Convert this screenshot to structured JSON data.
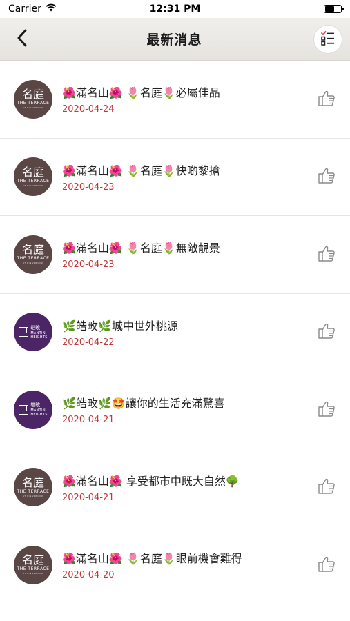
{
  "status_bar": {
    "carrier": "Carrier",
    "time": "12:31 PM",
    "battery_level": 0.6
  },
  "nav": {
    "title": "最新消息",
    "back_icon": "chevron-left-icon",
    "menu_icon": "checklist-icon"
  },
  "items": [
    {
      "logo_type": "terrace",
      "logo_main": "名庭",
      "logo_sub": "THE TERRACE",
      "logo_sub2": "AT KINGSWOOD",
      "title": "🌺滿名山🌺 🌷名庭🌷必屬佳品",
      "date": "2020-04-24"
    },
    {
      "logo_type": "terrace",
      "logo_main": "名庭",
      "logo_sub": "THE TERRACE",
      "logo_sub2": "AT KINGSWOOD",
      "title": "🌺滿名山🌺 🌷名庭🌷快啲黎搶",
      "date": "2020-04-23"
    },
    {
      "logo_type": "terrace",
      "logo_main": "名庭",
      "logo_sub": "THE TERRACE",
      "logo_sub2": "AT KINGSWOOD",
      "title": "🌺滿名山🌺 🌷名庭🌷無敵靚景",
      "date": "2020-04-23"
    },
    {
      "logo_type": "mantin",
      "logo_main": "皓畋",
      "logo_sub": "MANTIN",
      "logo_sub2": "HEIGHTS",
      "title": "🌿皓畋🌿城中世外桃源",
      "date": "2020-04-22"
    },
    {
      "logo_type": "mantin",
      "logo_main": "皓畋",
      "logo_sub": "MANTIN",
      "logo_sub2": "HEIGHTS",
      "title": "🌿皓畋🌿🤩讓你的生活充滿驚喜",
      "date": "2020-04-21"
    },
    {
      "logo_type": "terrace",
      "logo_main": "名庭",
      "logo_sub": "THE TERRACE",
      "logo_sub2": "AT KINGSWOOD",
      "title": "🌺滿名山🌺 享受都市中既大自然🌳",
      "date": "2020-04-21"
    },
    {
      "logo_type": "terrace",
      "logo_main": "名庭",
      "logo_sub": "THE TERRACE",
      "logo_sub2": "AT KINGSWOOD",
      "title": "🌺滿名山🌺 🌷名庭🌷眼前機會難得",
      "date": "2020-04-20"
    }
  ],
  "colors": {
    "date": "#c0393b",
    "terrace_logo": "#5b4646",
    "mantin_logo": "#4b2566"
  }
}
